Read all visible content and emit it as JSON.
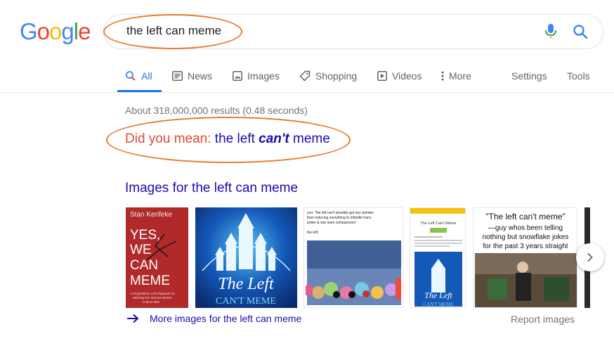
{
  "logo": {
    "letters": [
      "G",
      "o",
      "o",
      "g",
      "l",
      "e"
    ],
    "colors": [
      "#4285f4",
      "#ea4335",
      "#fbbc05",
      "#4285f4",
      "#34a853",
      "#ea4335"
    ]
  },
  "search": {
    "query": "the left can meme"
  },
  "tabs": [
    {
      "label": "All",
      "icon": "search-icon",
      "active": true
    },
    {
      "label": "News",
      "icon": "news-icon"
    },
    {
      "label": "Images",
      "icon": "image-icon"
    },
    {
      "label": "Shopping",
      "icon": "tag-icon"
    },
    {
      "label": "Videos",
      "icon": "play-icon"
    },
    {
      "label": "More",
      "icon": "more-vert-icon"
    }
  ],
  "tools": {
    "settings": "Settings",
    "tools": "Tools"
  },
  "stats": "About 318,000,000 results (0.48 seconds)",
  "did_you_mean": {
    "prefix": "Did you mean:",
    "before": "the left",
    "emphasis": "can't",
    "after": "meme"
  },
  "images_heading": "Images for the left can meme",
  "images": {
    "img1": {
      "author": "Stan Kerifeke",
      "l1": "YES,",
      "l2": "WE",
      "l3": "CAN",
      "l4": "MEME",
      "sub1": "A Progressive Left Playbook for",
      "sub2": "Winning the Internet Meme",
      "sub3": "Culture War"
    },
    "img2": {
      "title": "The Left",
      "sub": "CAN'T MEME"
    },
    "img3": {
      "t1": "you: \"the left can't possibly get any dumber",
      "t2": "than reducing everything to infantile harry",
      "t3": "potter & star wars comparisons\"",
      "t4": "the left:"
    },
    "img4": {
      "header": "The Left Can't Meme",
      "title": "The Left",
      "sub": "CAN'T MEME"
    },
    "img5": {
      "q": "\"The left can't meme\"",
      "l1": "—guy whos been telling",
      "l2": "nothing but snowflake jokes",
      "l3": "for the past 3 years straight"
    }
  },
  "more_images": "More images for the left can meme",
  "report_images": "Report images",
  "colors": {
    "accent": "#1a73e8",
    "link": "#1a0dab",
    "dym_red": "#dd4b39",
    "annotation": "#ea7a2f"
  }
}
